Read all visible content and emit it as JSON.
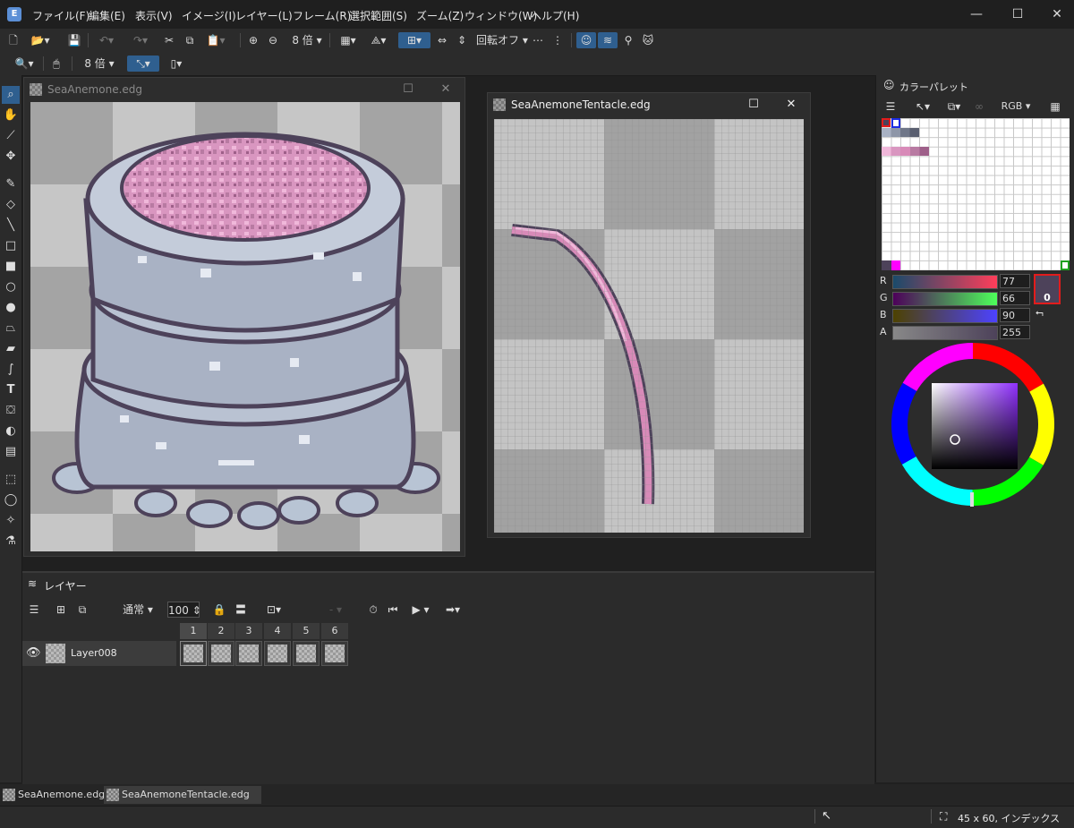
{
  "app": {
    "menus": [
      "ファイル(F)",
      "編集(E)",
      "表示(V)",
      "イメージ(I)",
      "レイヤー(L)",
      "フレーム(R)",
      "選択範囲(S)",
      "ズーム(Z)",
      "ウィンドウ(W)",
      "ヘルプ(H)"
    ]
  },
  "toolbar1": {
    "zoom_value": "8 倍",
    "rotate_label": "回転オフ"
  },
  "toolbar2": {
    "zoom_value": "8 倍"
  },
  "documents": [
    {
      "title": "SeaAnemone.edg",
      "active": false
    },
    {
      "title": "SeaAnemoneTentacle.edg",
      "active": true
    }
  ],
  "layers_panel": {
    "tab_label": "レイヤー",
    "blend_mode": "通常",
    "opacity": "100",
    "frames": [
      "1",
      "2",
      "3",
      "4",
      "5",
      "6"
    ],
    "layer_name": "Layer008"
  },
  "palette_panel": {
    "tab_label": "カラーパレット",
    "color_mode": "RGB",
    "r": "77",
    "g": "66",
    "b": "90",
    "a": "255",
    "primary_index": "0",
    "secondary_index": "1",
    "primary_color": "#4d425a"
  },
  "document_tabs": [
    "SeaAnemone.edg",
    "SeaAnemoneTentacle.edg"
  ],
  "status": {
    "image_info": "45 x 60, インデックス"
  },
  "colors": {
    "accent": "#2f5f8f",
    "pink": "#d88ab8",
    "outline": "#4d425a",
    "pot_gray": "#a9b2c4"
  }
}
